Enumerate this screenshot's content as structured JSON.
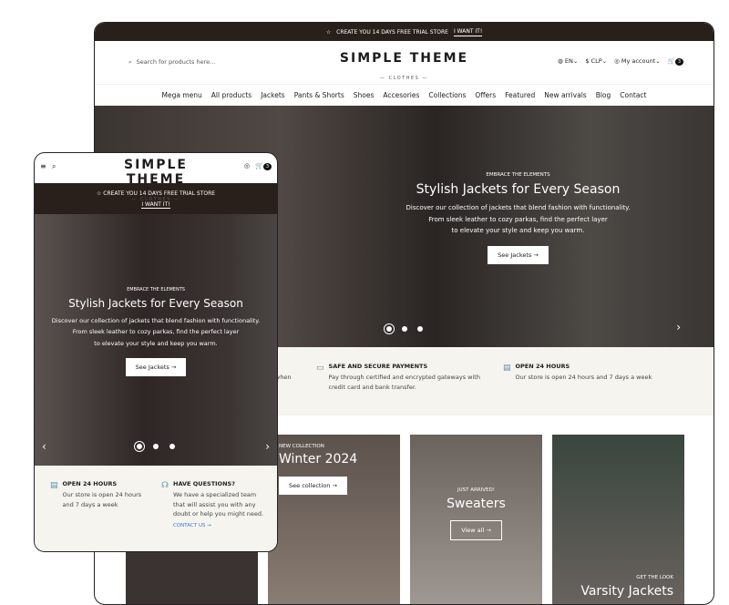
{
  "announcement": {
    "text": "CREATE YOU 14 DAYS FREE TRIAL STORE",
    "link": "I WANT IT!"
  },
  "logo": {
    "title": "SIMPLE THEME",
    "subtitle": "— CLOTHES —"
  },
  "search": {
    "placeholder": "Search for products here..."
  },
  "header": {
    "language": "EN",
    "currency": "CLP",
    "account": "My account",
    "cart_count": "3"
  },
  "nav": [
    "Mega menu",
    "All products",
    "Jackets",
    "Pants & Shorts",
    "Shoes",
    "Accesories",
    "Collections",
    "Offers",
    "Featured",
    "New arrivals",
    "Blog",
    "Contact"
  ],
  "hero": {
    "eyebrow": "EMBRACE THE ELEMENTS",
    "title": "Stylish Jackets for Every Season",
    "line1": "Discover our collection of jackets that blend fashion with functionality.",
    "line2": "From sleek leather to cozy parkas, find the perfect layer",
    "line3": "to elevate your style and keep you warm.",
    "button": "See Jackets →",
    "slides": 3,
    "active_slide": 1
  },
  "features": [
    {
      "partial": "when"
    },
    {
      "title": "SAFE AND SECURE PAYMENTS",
      "text": "Pay through certified and encrypted gateways with credit card and bank transfer.",
      "icon": "credit-card-icon"
    },
    {
      "title": "OPEN 24 HOURS",
      "text": "Our store is open 24 hours and 7 days a week",
      "icon": "store-icon"
    },
    {
      "title": "HAVE QUESTIONS?",
      "text": "We have a specialized team that will assist you with any doubt or help you might need.",
      "link": "CONTACT US →",
      "icon": "headset-icon"
    }
  ],
  "collections": [
    {
      "eyebrow": "NEW COLLECTION",
      "title": "Winter 2024",
      "button": "See collection →"
    },
    {
      "eyebrow": "JUST ARRIVED!",
      "title": "Sweaters",
      "button": "View all →"
    },
    {
      "eyebrow": "GET THE LOOK",
      "title": "Varsity Jackets"
    }
  ],
  "colors": {
    "dark": "#2a201b",
    "feature_bg": "#f5f4ef",
    "link": "#3a7bd5",
    "icon": "#5a8fb0"
  }
}
